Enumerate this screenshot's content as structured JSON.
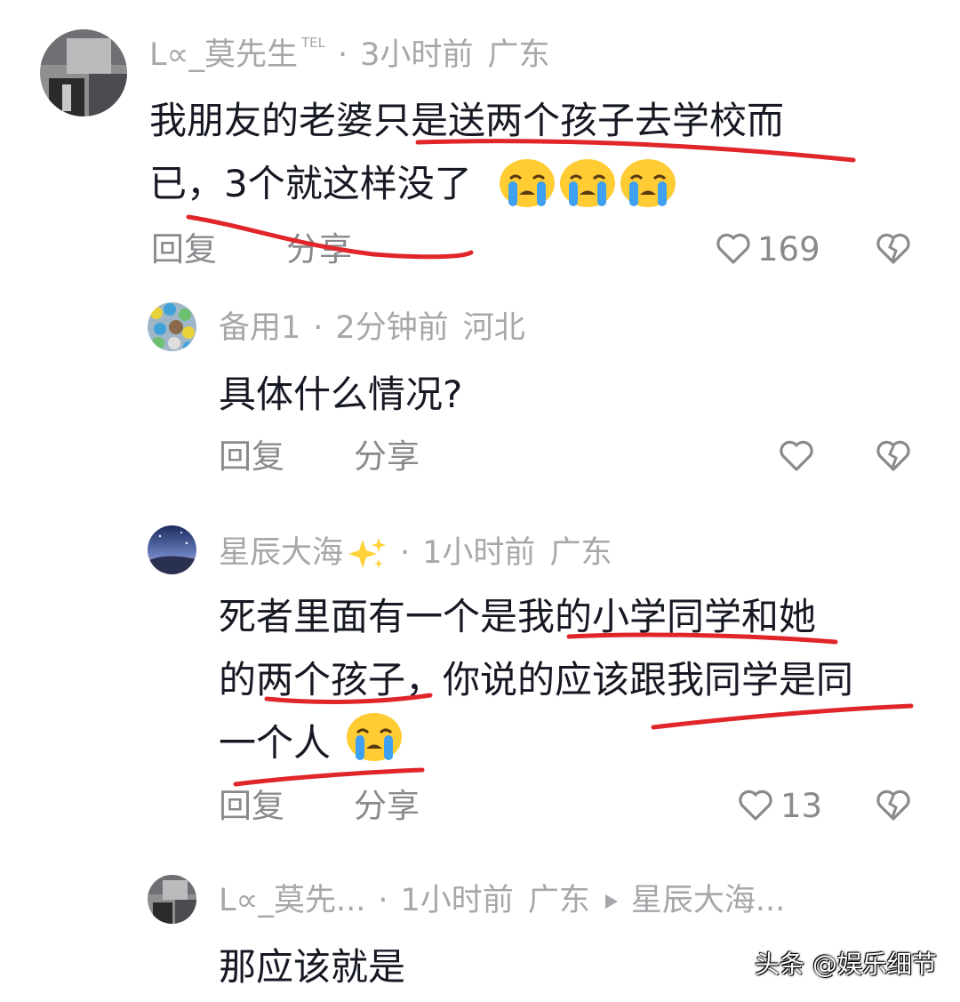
{
  "comments": [
    {
      "user": "L∝_莫先生",
      "user_badge": "TEL",
      "time": "3小时前",
      "location": "广东",
      "text_line1": "我朋友的老婆只是送两个孩子去学校而",
      "text_line2": "已，3个就这样没了",
      "reply_label": "回复",
      "share_label": "分享",
      "likes": "169"
    },
    {
      "user": "备用1",
      "time": "2分钟前",
      "location": "河北",
      "text_line1": "具体什么情况?",
      "reply_label": "回复",
      "share_label": "分享"
    },
    {
      "user": "星辰大海",
      "time": "1小时前",
      "location": "广东",
      "text_line1": "死者里面有一个是我的小学同学和她",
      "text_line2": "的两个孩子，你说的应该跟我同学是同",
      "text_line3": "一个人",
      "reply_label": "回复",
      "share_label": "分享",
      "likes": "13"
    },
    {
      "user": "L∝_莫先...",
      "time": "1小时前",
      "location": "广东",
      "reply_to": "星辰大海...",
      "text_line1": "那应该就是"
    }
  ],
  "separator": "·",
  "watermark": "头条 @娱乐细节",
  "colors": {
    "meta": "#a7a7ab",
    "text": "#161823",
    "action": "#8a8a8e",
    "annotation": "#e0262a"
  },
  "icons": [
    "heart-outline-icon",
    "broken-heart-icon",
    "crying-face-emoji",
    "sparkles-emoji",
    "play-triangle-icon"
  ]
}
